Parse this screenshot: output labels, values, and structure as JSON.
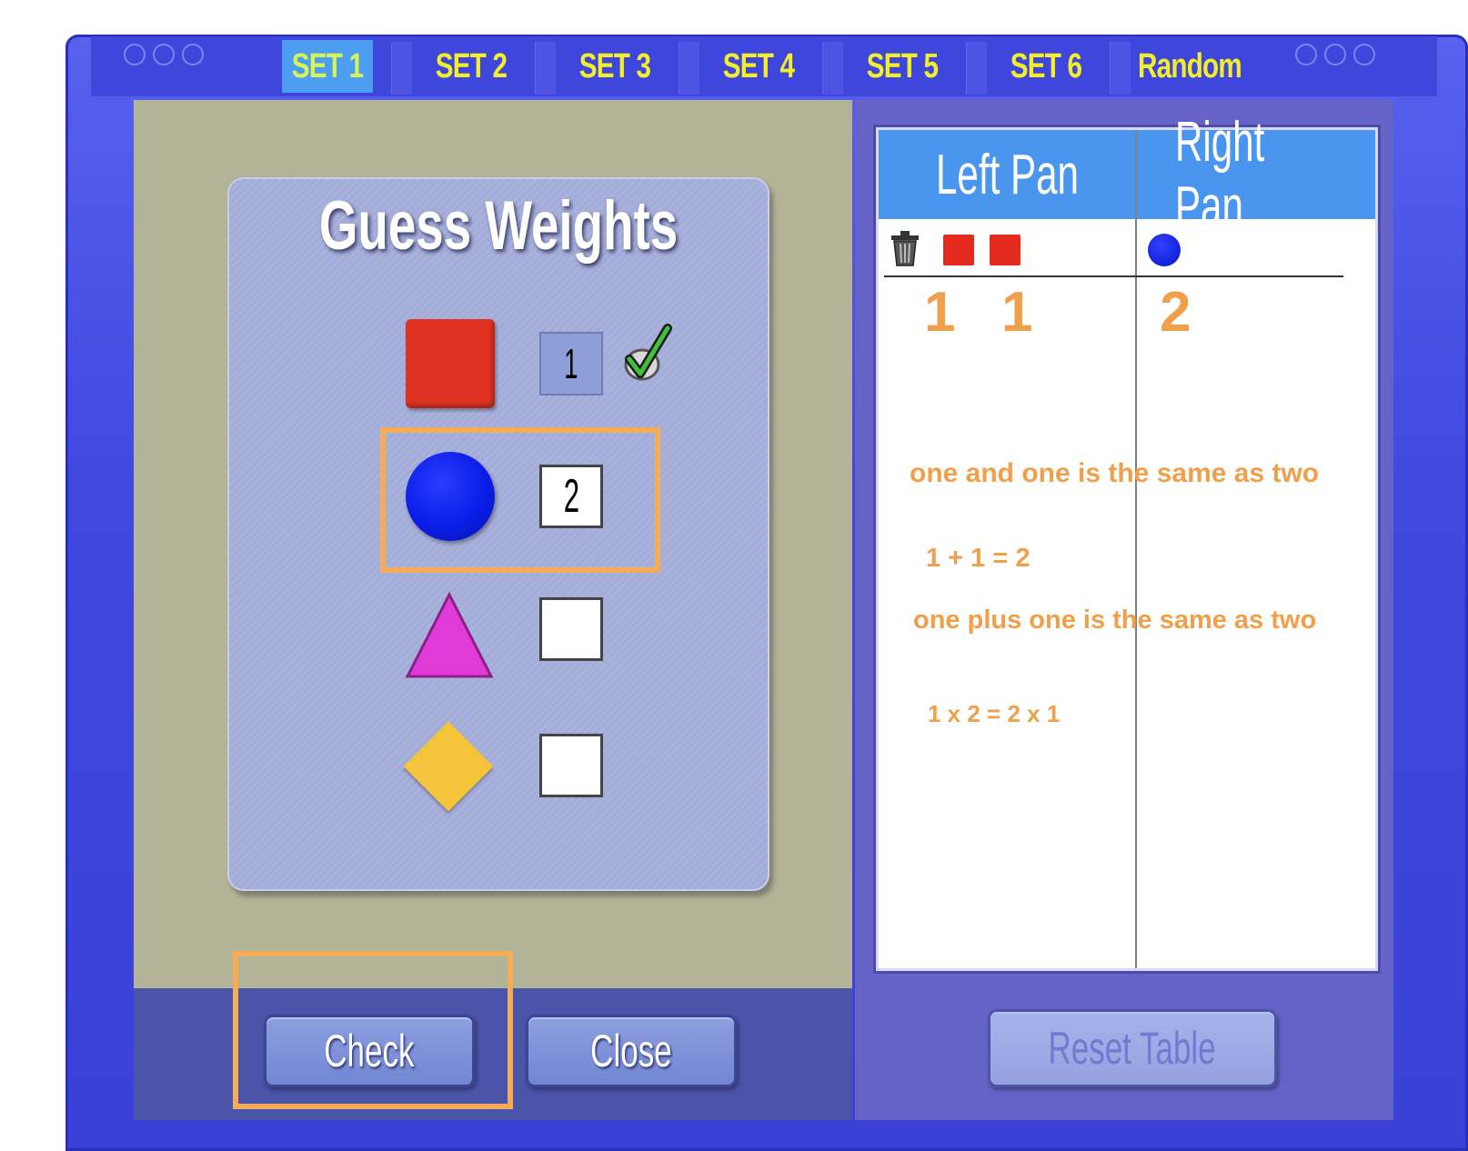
{
  "tabs": [
    "SET 1",
    "SET 2",
    "SET 3",
    "SET 4",
    "SET 5",
    "SET 6",
    "Random"
  ],
  "active_tab": "SET 1",
  "guess_panel": {
    "title": "Guess Weights",
    "rows": [
      {
        "shape": "red-square",
        "value": "1",
        "checked": true
      },
      {
        "shape": "blue-circle",
        "value": "2"
      },
      {
        "shape": "pink-triangle",
        "value": ""
      },
      {
        "shape": "yellow-diamond",
        "value": ""
      }
    ]
  },
  "table": {
    "left_header": "Left Pan",
    "right_header": "Right Pan",
    "left_items": [
      "red-square",
      "red-square"
    ],
    "right_items": [
      "blue-circle"
    ],
    "left_numbers": [
      "1",
      "1"
    ],
    "right_number": "2"
  },
  "annotations": [
    "one and one is the same as two",
    "1 + 1 = 2",
    "one plus one is the same as two",
    "1 x 2 = 2 x 1"
  ],
  "buttons": {
    "check": "Check",
    "close": "Close",
    "reset": "Reset Table"
  },
  "colors": {
    "frame": "#4048e0",
    "tab_text": "#f3ee2a",
    "annotation": "#f0a04a",
    "table_header": "#4a96ee"
  }
}
